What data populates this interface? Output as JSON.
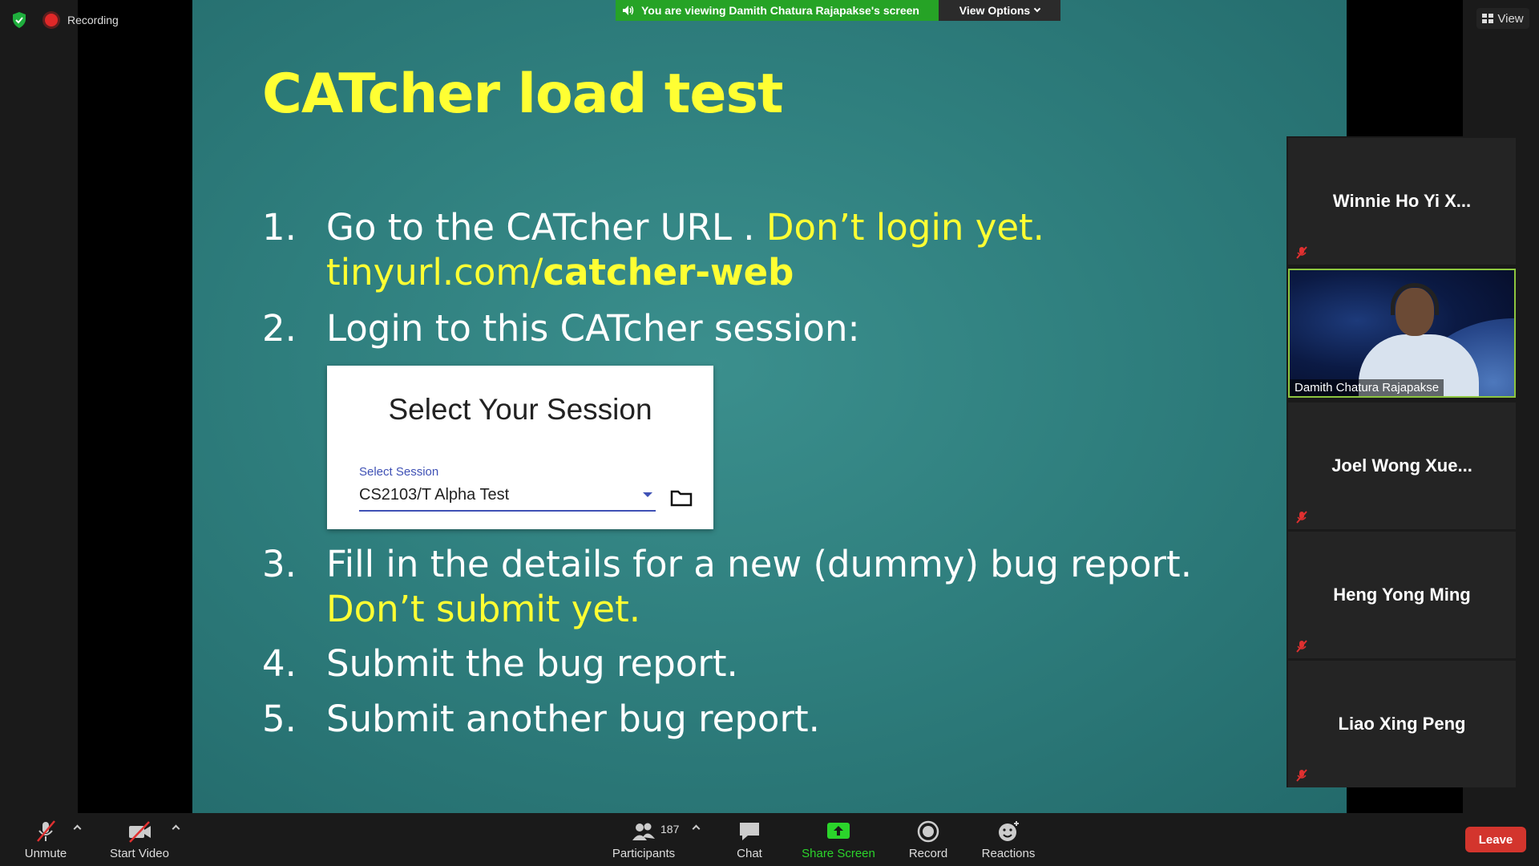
{
  "recording": {
    "label": "Recording"
  },
  "banner": {
    "viewing_text": "You are viewing Damith Chatura Rajapakse's screen",
    "options_label": "View Options"
  },
  "view_button": {
    "label": "View"
  },
  "slide": {
    "title": "CATcher load test",
    "items": [
      {
        "num": "1.",
        "line1_a": "Go to the CATcher URL . ",
        "line1_b": "Don’t login yet.",
        "line2_a": "tinyurl.com/",
        "line2_b": "catcher-web"
      },
      {
        "num": "2.",
        "text": "Login to this CATcher session:"
      },
      {
        "num": "3.",
        "line1": "Fill in the details for a new (dummy) bug report.",
        "line2": "Don’t submit yet."
      },
      {
        "num": "4.",
        "text": "Submit the bug report."
      },
      {
        "num": "5.",
        "text": "Submit another bug report."
      }
    ],
    "session_box": {
      "title": "Select Your Session",
      "label": "Select Session",
      "value": "CS2103/T Alpha Test"
    }
  },
  "gallery": {
    "participants": [
      {
        "name": "Winnie Ho Yi X...",
        "muted": true
      },
      {
        "name": "Damith Chatura Rajapakse",
        "video": true
      },
      {
        "name": "Joel Wong Xue...",
        "muted": true
      },
      {
        "name": "Heng Yong Ming",
        "muted": true
      },
      {
        "name": "Liao Xing Peng",
        "muted": true
      }
    ]
  },
  "toolbar": {
    "unmute": "Unmute",
    "start_video": "Start Video",
    "participants": "Participants",
    "participants_count": "187",
    "chat": "Chat",
    "share_screen": "Share Screen",
    "record": "Record",
    "reactions": "Reactions",
    "leave": "Leave"
  },
  "colors": {
    "slide_bg": "#2f7f7e",
    "yellow": "#ffff33",
    "share_green": "#2bd42b",
    "leave_red": "#d3352d",
    "banner_green": "#26a326"
  }
}
